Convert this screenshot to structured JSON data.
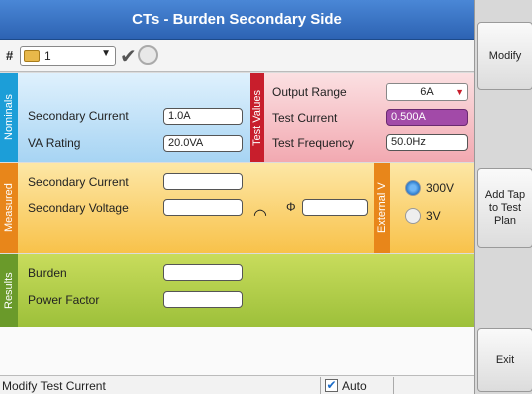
{
  "title": "CTs - Burden Secondary Side",
  "toolbar": {
    "hash": "#",
    "tap_selector": "1"
  },
  "nominals": {
    "tab": "Nominals",
    "secondary_current_label": "Secondary Current",
    "secondary_current_value": "1.0A",
    "va_rating_label": "VA Rating",
    "va_rating_value": "20.0VA"
  },
  "test_values": {
    "tab": "Test Values",
    "output_range_label": "Output Range",
    "output_range_value": "6A",
    "test_current_label": "Test Current",
    "test_current_value": "0.500A",
    "test_frequency_label": "Test Frequency",
    "test_frequency_value": "50.0Hz"
  },
  "measured": {
    "tab": "Measured",
    "secondary_current_label": "Secondary Current",
    "secondary_current_value": "",
    "secondary_voltage_label": "Secondary Voltage",
    "secondary_voltage_value": "",
    "phi_label": "Φ",
    "phi_value": ""
  },
  "external_v": {
    "tab": "External V",
    "option_300": "300V",
    "option_3": "3V",
    "selected": "300V"
  },
  "results": {
    "tab": "Results",
    "burden_label": "Burden",
    "burden_value": "",
    "power_factor_label": "Power Factor",
    "power_factor_value": ""
  },
  "status": {
    "message": "Modify Test Current",
    "auto_label": "Auto",
    "auto_checked": true
  },
  "right_panel": {
    "modify": "Modify",
    "add_tap": "Add Tap to Test Plan",
    "exit": "Exit"
  },
  "colors": {
    "title_bar": "#2d63b3",
    "nominals": "#1c9ed8",
    "test_values": "#c81e2c",
    "measured": "#e8861a",
    "results": "#6a9a2a",
    "test_current_highlight": "#a24aa8"
  }
}
